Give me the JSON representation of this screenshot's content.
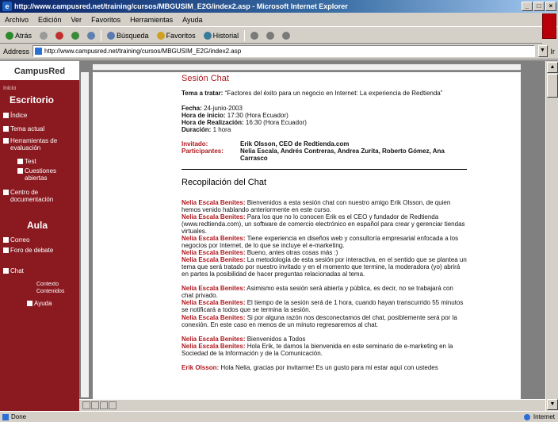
{
  "window": {
    "title": "http://www.campusred.net/training/cursos/MBGUSIM_E2G/index2.asp - Microsoft Internet Explorer"
  },
  "menu": [
    "Archivo",
    "Edición",
    "Ver",
    "Favoritos",
    "Herramientas",
    "Ayuda"
  ],
  "toolbar": {
    "back": "Atrás",
    "search": "Búsqueda",
    "favorites": "Favoritos",
    "history": "Historial"
  },
  "address": {
    "label": "Address",
    "url": "http://www.campusred.net/training/cursos/MBGUSIM_E2G/index2.asp",
    "go": "Ir"
  },
  "sidebar": {
    "logo": "CampusRed",
    "intro_small": "Inicio",
    "escritorio": "Escritorio",
    "items_escritorio": [
      "Índice",
      "Tema actual",
      "Herramientas de evaluación",
      "Test",
      "Cuestiones abiertas",
      "Centro de documentación"
    ],
    "aula": "Aula",
    "items_aula": [
      "Correo",
      "Foro de debate",
      "Chat",
      "Contexto",
      "Contenidos",
      "Ayuda"
    ]
  },
  "doc": {
    "title": "Sesión Chat",
    "tema_label": "Tema a tratar:",
    "tema_value": "“Factores del éxito para un negocio en Internet: La experiencia de Redtienda”",
    "fecha_label": "Fecha:",
    "fecha_value": "24-junio-2003",
    "hora_inicio_label": "Hora de inicio:",
    "hora_inicio_value": "17:30 (Hora Ecuador)",
    "hora_real_label": "Hora de Realización:",
    "hora_real_value": "16:30 (Hora Ecuador)",
    "duracion_label": "Duración:",
    "duracion_value": "1 hora",
    "invitado_label": "Invitado:",
    "invitado_value": "Erik Olsson, CEO de Redtienda.com",
    "participantes_label": "Participantes:",
    "participantes_value": "Nelia Escala, Andrés Contreras, Andrea Zurita, Roberto Gómez, Ana Carrasco",
    "recopilacion": "Recopilación del Chat",
    "chat": [
      {
        "speaker": "Nelia Escala Benites:",
        "text": "Bienvenidos a esta sesión chat con nuestro amigo Erik Olsson, de quien hemos venido hablando anteriormente en este curso."
      },
      {
        "speaker": "Nelia Escala Benites:",
        "text": "Para los que no lo conocen Erik es el CEO y fundador de Redtienda (www.redtienda.com), un software de comercio electrónico en español para crear y gerenciar tiendas virtuales."
      },
      {
        "speaker": "Nelia Escala Benites:",
        "text": "Tiene experiencia en diseños web y consultoría empresarial enfocada a los negocios por Internet, de lo que se incluye el e-marketing."
      },
      {
        "speaker": "Nelia Escala Benites:",
        "text": "Bueno, antes otras cosas más :)"
      },
      {
        "speaker": "Nelia Escala Benites:",
        "text": "La metodología de esta sesión por interactiva, en el sentido que se plantea un tema que será tratado por nuestro invitado y en el momento que termine, la moderadora (yo) abrirá en partes la posibilidad de hacer preguntas relacionadas al tema."
      },
      {
        "speaker": "Nelia Escala Benites:",
        "text": "Asimismo esta sesión será abierta y pública, es decir, no se trabajará con chat privado."
      },
      {
        "speaker": "Nelia Escala Benites:",
        "text": "El tiempo de la sesión será de 1 hora, cuando hayan transcurrido 55 minutos se notificará a todos que se termina la sesión."
      },
      {
        "speaker": "Nelia Escala Benites:",
        "text": "Si por alguna razón nos desconectamos del chat, posiblemente será por la conexión. En este caso en menos de un minuto regresaremos al chat."
      },
      {
        "speaker": "Nelia Escala Benites:",
        "text": "Bienvenidos a Todos"
      },
      {
        "speaker": "Nelia Escala Benites:",
        "text": "Hola Erik, te damos la bienvenida en este seminario de e-marketing en la Sociedad de la Información y de la Comunicación."
      },
      {
        "speaker": "Erik Olsson:",
        "text": "Hola Nelia, gracias por invitarme! Es un gusto para mi estar aquí con ustedes"
      }
    ]
  },
  "status": {
    "left": "Done",
    "right": "Internet"
  }
}
